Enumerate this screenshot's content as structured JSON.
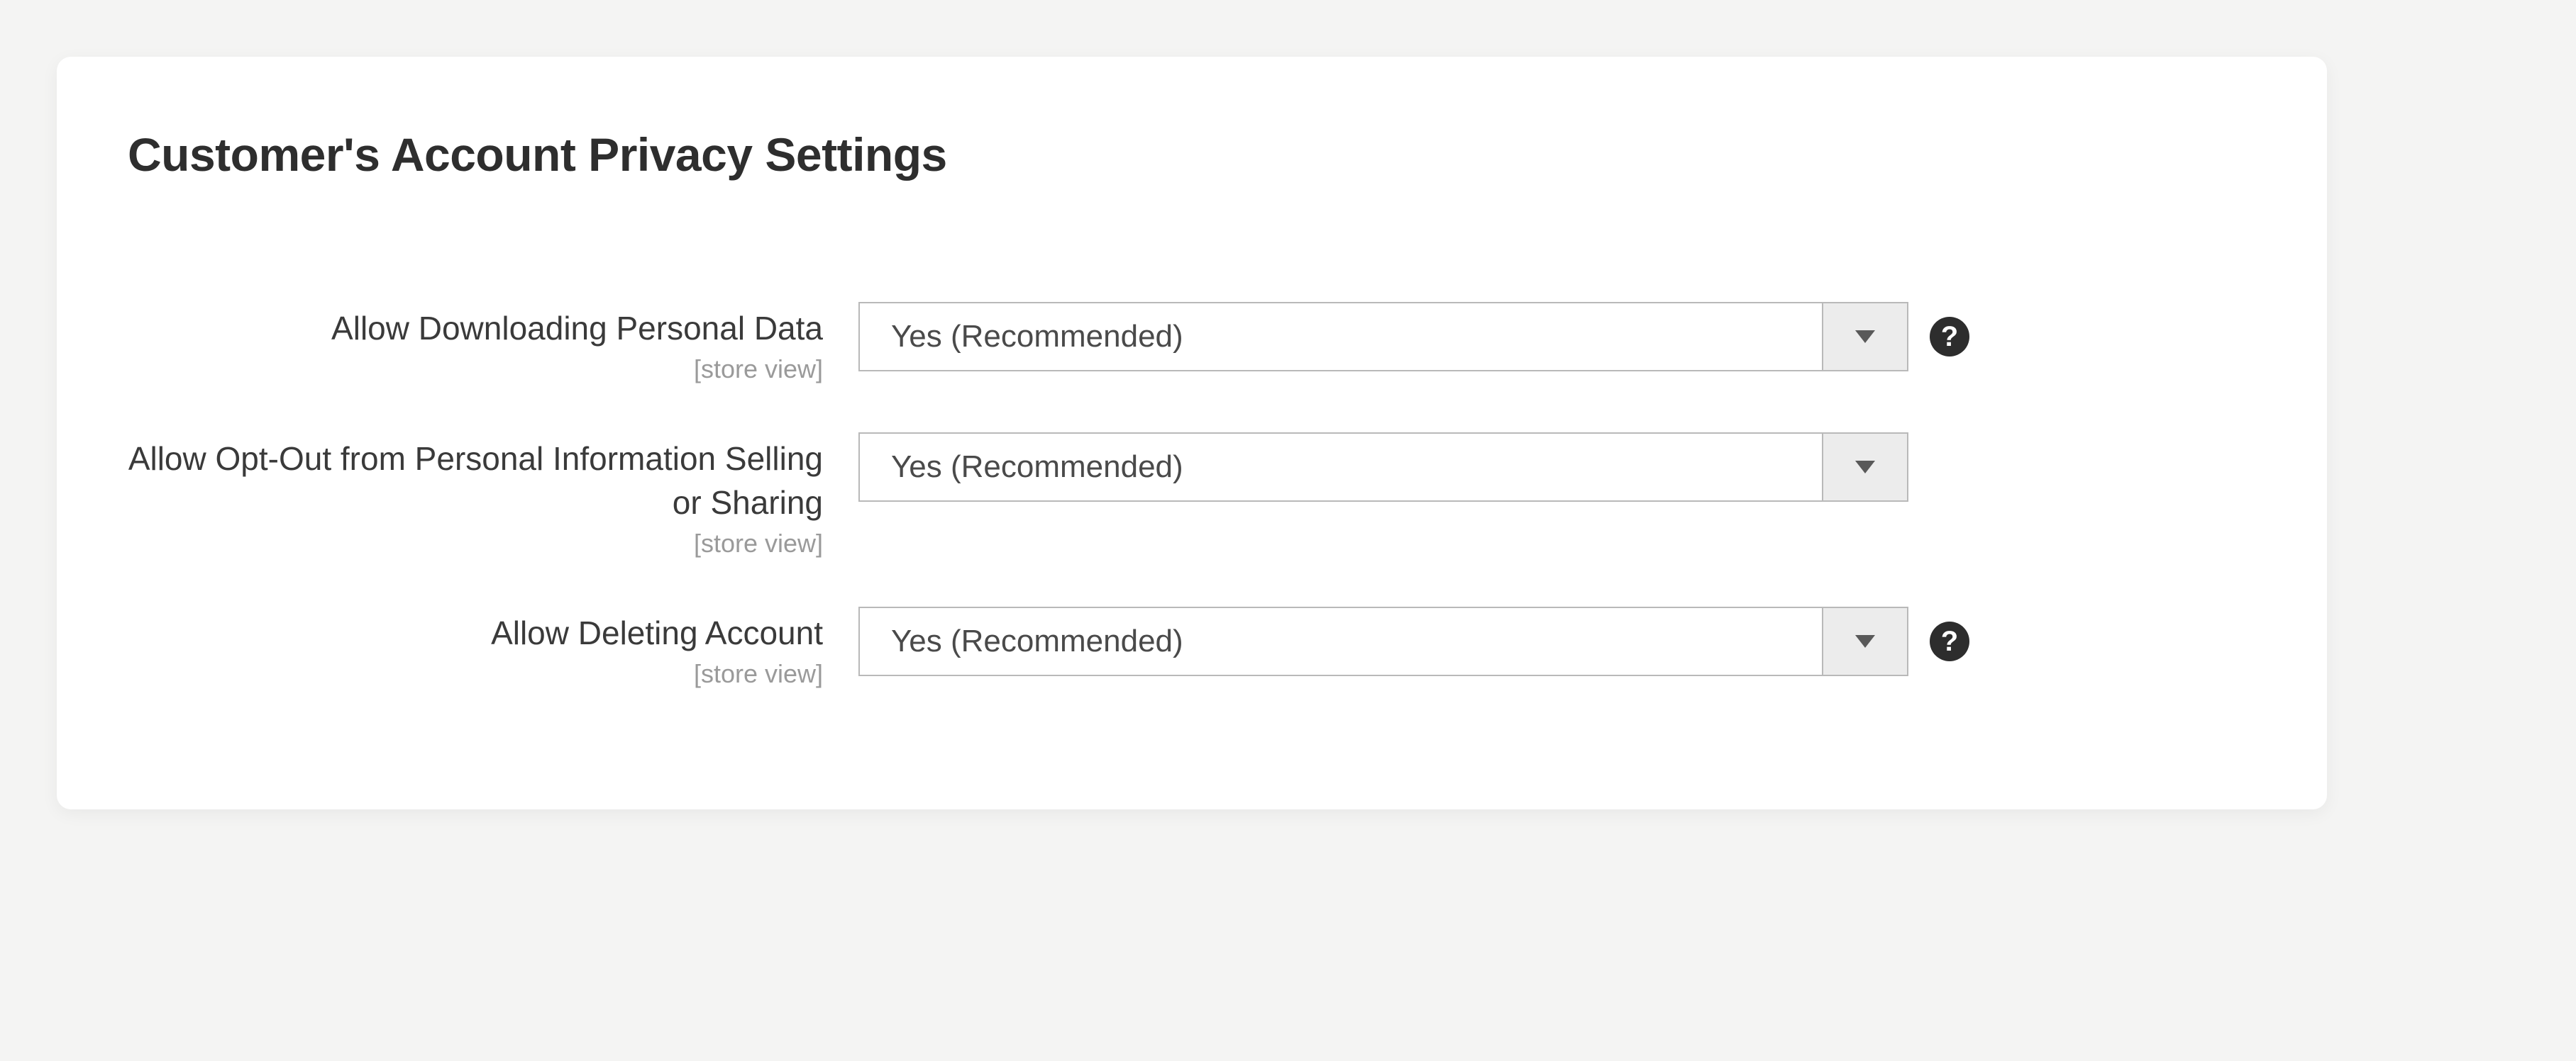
{
  "panel": {
    "title": "Customer's Account Privacy Settings"
  },
  "scope_label": "[store view]",
  "fields": {
    "download_personal_data": {
      "label": "Allow Downloading Personal Data",
      "value": "Yes (Recommended)"
    },
    "opt_out": {
      "label": "Allow Opt-Out from Personal Information Selling or Sharing",
      "value": "Yes (Recommended)"
    },
    "delete_account": {
      "label": "Allow Deleting Account",
      "value": "Yes (Recommended)"
    }
  },
  "icons": {
    "help_glyph": "?"
  }
}
